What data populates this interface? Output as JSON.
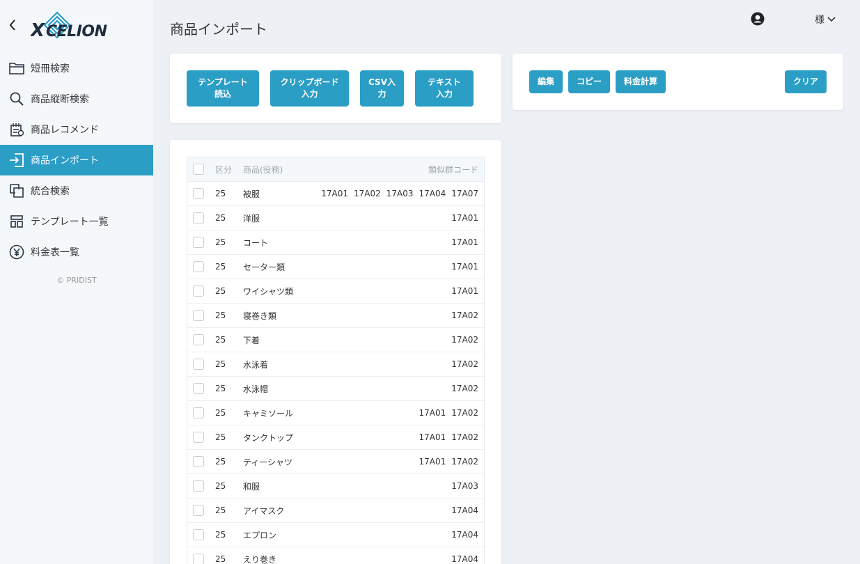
{
  "app": {
    "logo_text": "XCELION"
  },
  "header": {
    "title": "商品インポート",
    "user_suffix": "様"
  },
  "sidebar": {
    "items": [
      {
        "label": "短冊検索",
        "icon": "folder-icon"
      },
      {
        "label": "商品縦断検索",
        "icon": "search-icon"
      },
      {
        "label": "商品レコメンド",
        "icon": "recommend-icon"
      },
      {
        "label": "商品インポート",
        "icon": "import-icon",
        "active": true
      },
      {
        "label": "統合検索",
        "icon": "integrated-search-icon"
      },
      {
        "label": "テンプレート一覧",
        "icon": "template-icon"
      },
      {
        "label": "料金表一覧",
        "icon": "yen-icon"
      }
    ],
    "copyright": "© PRIDIST"
  },
  "import_actions": {
    "template_load": "テンプレート\n読込",
    "clipboard_input": "クリップボード\n入力",
    "csv_input": "CSV入\n力",
    "text_input": "テキスト\n入力"
  },
  "tools": {
    "edit": "編集",
    "copy": "コピー",
    "fee_calc": "料金計算",
    "clear": "クリア"
  },
  "table": {
    "headers": {
      "kubun": "区分",
      "product": "商品(役務)",
      "codes": "類似群コード"
    },
    "rows": [
      {
        "kubun": "25",
        "name": "被服",
        "codes": [
          "17A01",
          "17A02",
          "17A03",
          "17A04",
          "17A07"
        ]
      },
      {
        "kubun": "25",
        "name": "洋服",
        "codes": [
          "17A01"
        ]
      },
      {
        "kubun": "25",
        "name": "コート",
        "codes": [
          "17A01"
        ]
      },
      {
        "kubun": "25",
        "name": "セーター類",
        "codes": [
          "17A01"
        ]
      },
      {
        "kubun": "25",
        "name": "ワイシャツ類",
        "codes": [
          "17A01"
        ]
      },
      {
        "kubun": "25",
        "name": "寝巻き類",
        "codes": [
          "17A02"
        ]
      },
      {
        "kubun": "25",
        "name": "下着",
        "codes": [
          "17A02"
        ]
      },
      {
        "kubun": "25",
        "name": "水泳着",
        "codes": [
          "17A02"
        ]
      },
      {
        "kubun": "25",
        "name": "水泳帽",
        "codes": [
          "17A02"
        ]
      },
      {
        "kubun": "25",
        "name": "キャミソール",
        "codes": [
          "17A01",
          "17A02"
        ]
      },
      {
        "kubun": "25",
        "name": "タンクトップ",
        "codes": [
          "17A01",
          "17A02"
        ]
      },
      {
        "kubun": "25",
        "name": "ティーシャツ",
        "codes": [
          "17A01",
          "17A02"
        ]
      },
      {
        "kubun": "25",
        "name": "和服",
        "codes": [
          "17A03"
        ]
      },
      {
        "kubun": "25",
        "name": "アイマスク",
        "codes": [
          "17A04"
        ]
      },
      {
        "kubun": "25",
        "name": "エプロン",
        "codes": [
          "17A04"
        ]
      },
      {
        "kubun": "25",
        "name": "えり巻き",
        "codes": [
          "17A04"
        ]
      }
    ]
  },
  "colors": {
    "accent": "#2b9ec6",
    "background": "#edf0f4",
    "sidebar": "#f4f8fb"
  }
}
